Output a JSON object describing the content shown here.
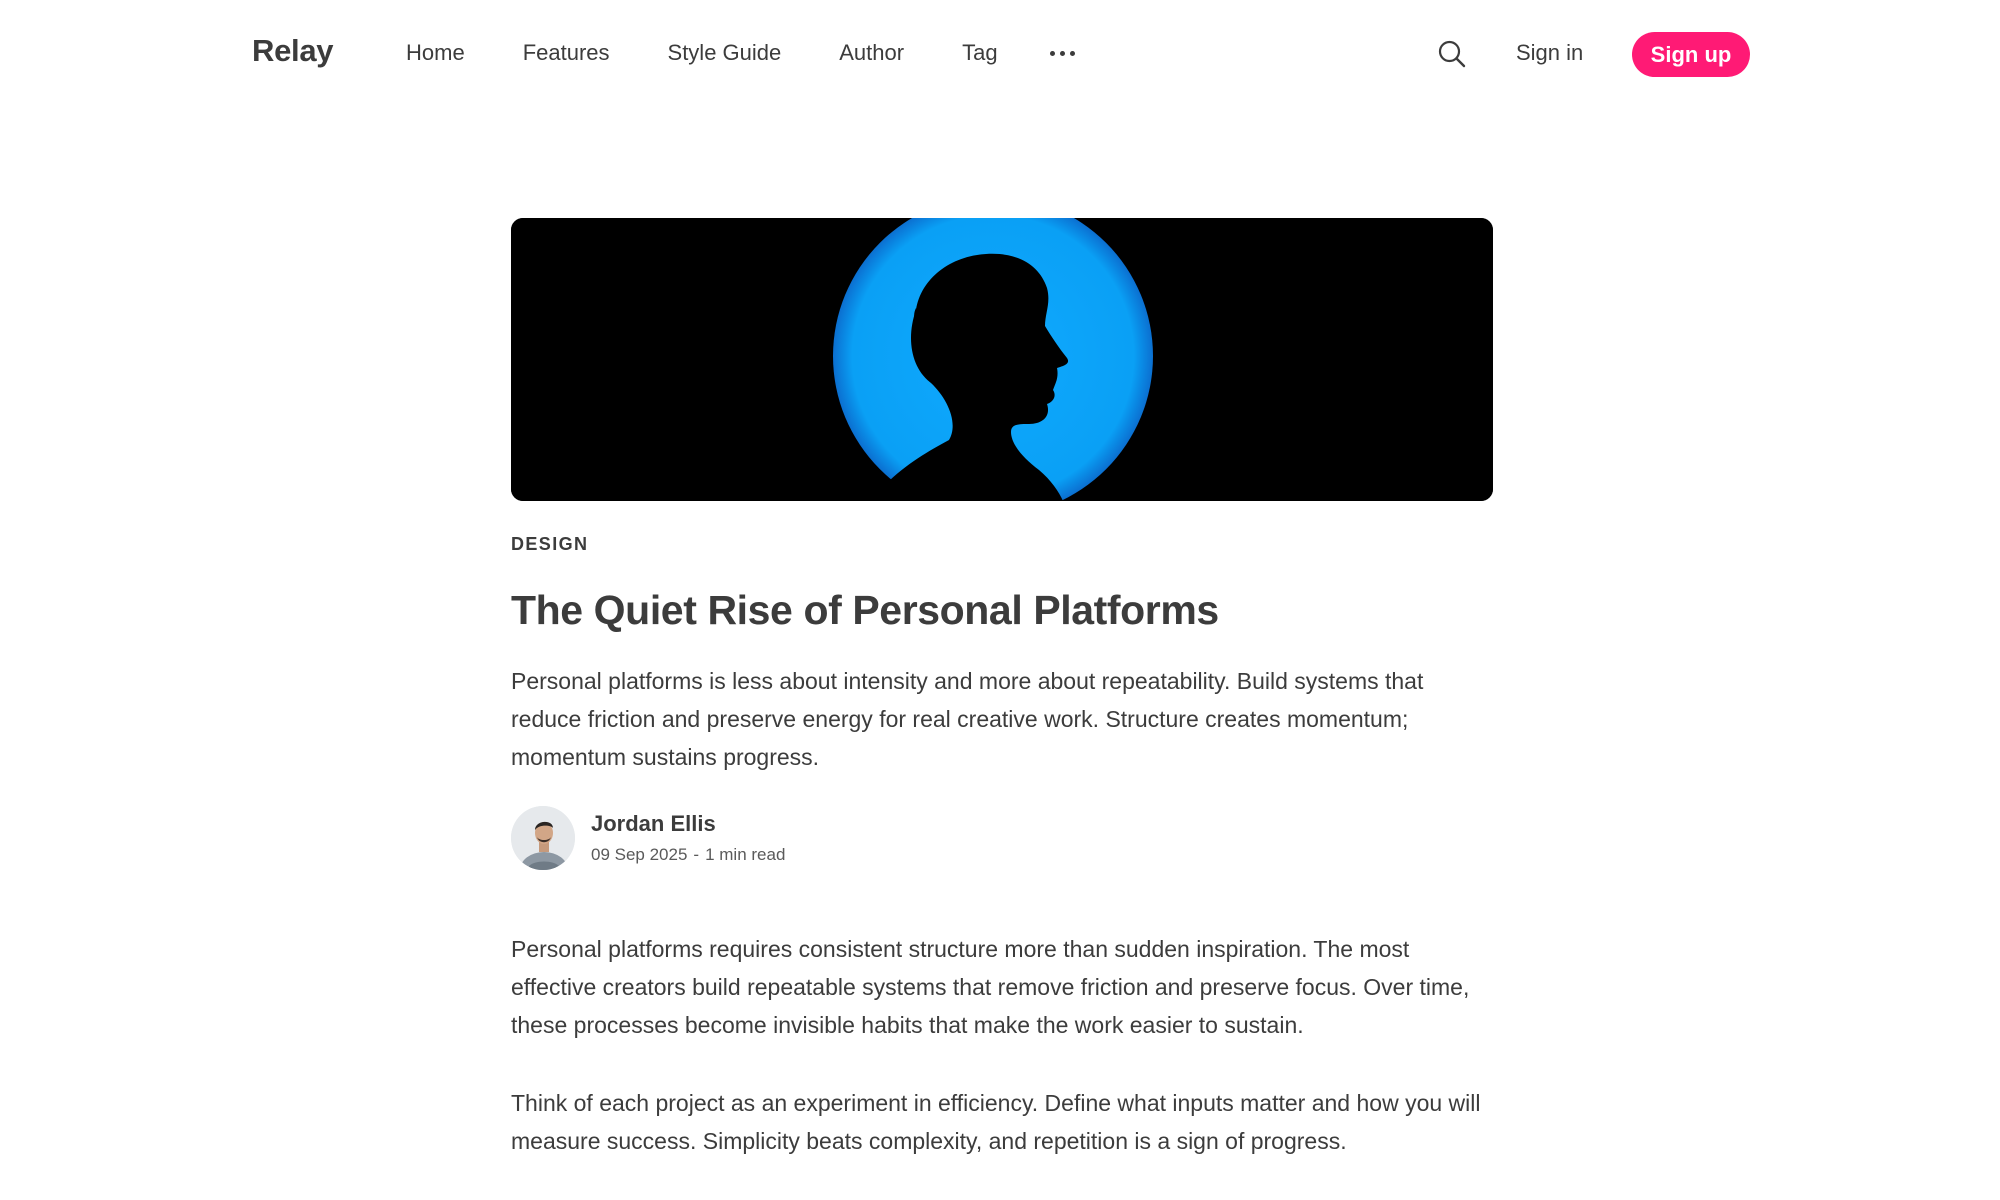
{
  "brand": {
    "name": "Relay",
    "accent_color": "#ff1a75"
  },
  "nav": {
    "items": [
      {
        "label": "Home"
      },
      {
        "label": "Features"
      },
      {
        "label": "Style Guide"
      },
      {
        "label": "Author"
      },
      {
        "label": "Tag"
      }
    ],
    "more_icon": "ellipsis-icon"
  },
  "header_actions": {
    "search_icon": "search-icon",
    "signin_label": "Sign in",
    "signup_label": "Sign up"
  },
  "article": {
    "hero_image": "silhouette of a person in profile against a blue circle on black background",
    "tag": "DESIGN",
    "title": "The Quiet Rise of Personal Platforms",
    "excerpt": "Personal platforms is less about intensity and more about repeatability. Build systems that reduce friction and preserve energy for real creative work. Structure creates momentum; momentum sustains progress.",
    "author": {
      "name": "Jordan Ellis",
      "avatar": "author-avatar"
    },
    "date": "09 Sep 2025",
    "separator": "-",
    "read_time": "1 min read",
    "paragraphs": [
      "Personal platforms requires consistent structure more than sudden inspiration. The most effective creators build repeatable systems that remove friction and preserve focus. Over time, these processes become invisible habits that make the work easier to sustain.",
      "Think of each project as an experiment in efficiency. Define what inputs matter and how you will measure success. Simplicity beats complexity, and repetition is a sign of progress."
    ]
  }
}
